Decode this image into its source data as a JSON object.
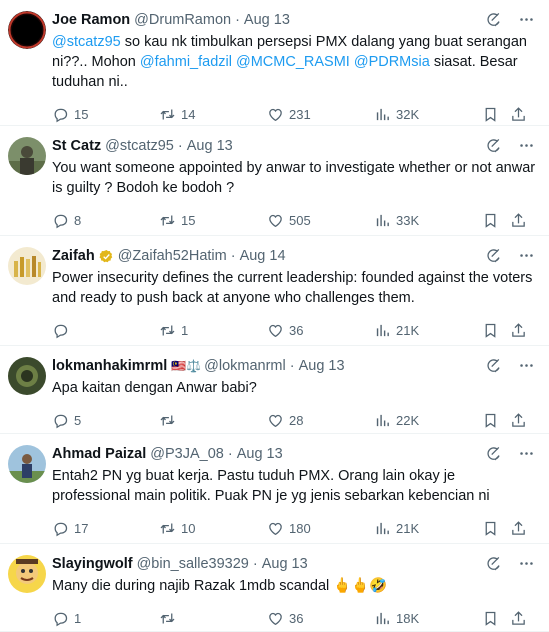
{
  "tweets": [
    {
      "name": "Joe Ramon",
      "handle": "@DrumRamon",
      "date": "Aug 13",
      "text_parts": [
        "@stcatz95",
        " so kau nk timbulkan persepsi PMX dalang yang buat serangan ni??.. Mohon ",
        "@fahmi_fadzil",
        " ",
        "@MCMC_RASMI",
        " ",
        "@PDRMsia",
        " siasat. Besar tuduhan ni.."
      ],
      "replies": "15",
      "retweets": "14",
      "likes": "231",
      "views": "32K"
    },
    {
      "name": "St Catz",
      "handle": "@stcatz95",
      "date": "Aug 13",
      "text": "You want someone appointed by anwar to investigate whether or not anwar is guilty ? Bodoh ke bodoh ?",
      "replies": "8",
      "retweets": "15",
      "likes": "505",
      "views": "33K"
    },
    {
      "name": "Zaifah",
      "handle": "@Zaifah52Hatim",
      "date": "Aug 14",
      "text": "Power insecurity defines the current leadership: founded against the voters and ready to push back at anyone who challenges them.",
      "replies": "",
      "retweets": "1",
      "likes": "36",
      "views": "21K"
    },
    {
      "name": "lokmanhakimrml",
      "handle": "@lokmanrml",
      "date": "Aug 13",
      "text": "Apa kaitan dengan Anwar babi?",
      "replies": "5",
      "retweets": "",
      "likes": "28",
      "views": "22K"
    },
    {
      "name": "Ahmad Paizal",
      "handle": "@P3JA_08",
      "date": "Aug 13",
      "text": "Entah2 PN yg buat kerja. Pastu tuduh PMX. Orang lain okay je professional main politik. Puak PN je yg jenis sebarkan kebencian ni",
      "replies": "17",
      "retweets": "10",
      "likes": "180",
      "views": "21K"
    },
    {
      "name": "Slayingwolf",
      "handle": "@bin_salle39329",
      "date": "Aug 13",
      "text": "Many die during najib Razak 1mdb scandal 🖕🖕🤣",
      "replies": "1",
      "retweets": "",
      "likes": "36",
      "views": "18K"
    }
  ],
  "flag_emoji": "🇲🇾⚖️",
  "dot": "·",
  "colors": {
    "accent": "#1d9bf0",
    "muted": "#536471",
    "border": "#eff3f4",
    "verified_gold": "#e2b719"
  }
}
